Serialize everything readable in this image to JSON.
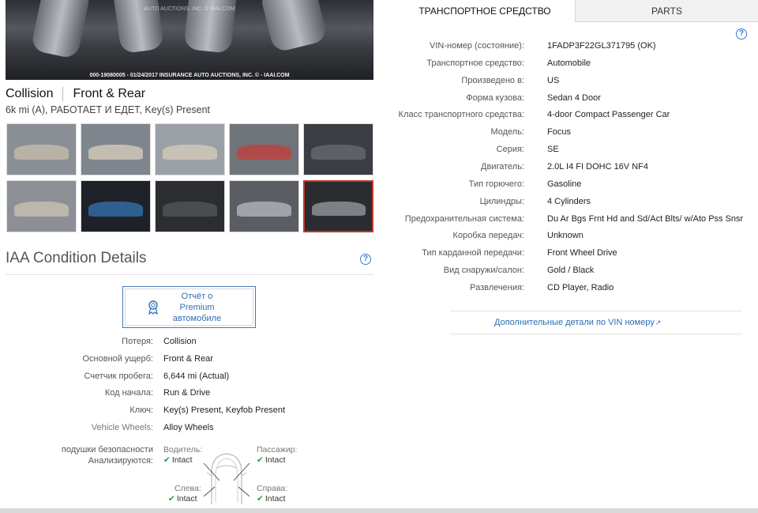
{
  "main_photo": {
    "watermark": "AUTO AUCTIONS, INC. © IAAI.COM",
    "caption": "000-19080005 - 01/24/2017 INSURANCE AUTO AUCTIONS, INC. © - IAAI.COM"
  },
  "vehicle": {
    "primary_damage_title": "Collision",
    "damage_location_title": "Front & Rear",
    "subtitle": "6k mi (A), РАБОТАЕТ И ЕДЕТ, Key(s) Present"
  },
  "thumbnails": [
    {
      "name": "thumb-1",
      "bg": "#8a8f96",
      "car": "#b9b2a6"
    },
    {
      "name": "thumb-2",
      "bg": "#7f858c",
      "car": "#c2bcb1"
    },
    {
      "name": "thumb-3",
      "bg": "#9aa0a6",
      "car": "#c8c1b5"
    },
    {
      "name": "thumb-4",
      "bg": "#6f747b",
      "car": "#b04a4a"
    },
    {
      "name": "thumb-5",
      "bg": "#3b3d42",
      "car": "#5e6066"
    },
    {
      "name": "thumb-6",
      "bg": "#8c9096",
      "car": "#bdb6aa"
    },
    {
      "name": "thumb-7",
      "bg": "#1e2228",
      "car": "#2f5f8f"
    },
    {
      "name": "thumb-8",
      "bg": "#2b2d31",
      "car": "#4a4c51"
    },
    {
      "name": "thumb-9",
      "bg": "#5a5d62",
      "car": "#9fa4aa"
    },
    {
      "name": "thumb-10",
      "bg": "#2a2c30",
      "car": "#7d8086"
    }
  ],
  "condition": {
    "title": "IAA Condition Details",
    "premium_button": "Отчёт о Premium автомобиле",
    "rows": [
      {
        "label": "Потеря:",
        "value": "Collision"
      },
      {
        "label": "Основной ущерб:",
        "value": "Front & Rear"
      },
      {
        "label": "Счетчик пробега:",
        "value": "6,644 mi (Actual)"
      },
      {
        "label": "Код начала:",
        "value": "Run & Drive"
      },
      {
        "label": "Ключ:",
        "value": "Key(s) Present, Keyfob Present"
      },
      {
        "label": "Vehicle Wheels:",
        "value": "Alloy Wheels"
      }
    ],
    "airbags_label_line1": "подушки безопасности",
    "airbags_label_line2": "Анализируются:",
    "airbags": {
      "driver": {
        "position": "Водитель:",
        "status": "Intact"
      },
      "passenger": {
        "position": "Пассажир:",
        "status": "Intact"
      },
      "left": {
        "position": "Слева:",
        "status": "Intact"
      },
      "right": {
        "position": "Справа:",
        "status": "Intact"
      }
    },
    "check_icon": "check-icon"
  },
  "tabs": {
    "vehicle": "ТРАНСПОРТНОЕ СРЕДСТВО",
    "parts": "PARTS"
  },
  "specs": [
    {
      "label": "VIN-номер (состояние):",
      "value": "1FADP3F22GL371795 (OK)"
    },
    {
      "label": "Транспортное средство:",
      "value": "Automobile"
    },
    {
      "label": "Произведено в:",
      "value": "US"
    },
    {
      "label": "Форма кузова:",
      "value": "Sedan 4 Door"
    },
    {
      "label": "Класс транспортного средства:",
      "value": "4-door Compact Passenger Car"
    },
    {
      "label": "Модель:",
      "value": "Focus"
    },
    {
      "label": "Серия:",
      "value": "SE"
    },
    {
      "label": "Двигатель:",
      "value": "2.0L I4 FI DOHC 16V NF4"
    },
    {
      "label": "Тип горючего:",
      "value": "Gasoline"
    },
    {
      "label": "Цилиндры:",
      "value": "4 Cylinders"
    },
    {
      "label": "Предохранительная система:",
      "value": "Du Ar Bgs Frnt Hd and Sd/Act Blts/ w/Ato Pss Snsr"
    },
    {
      "label": "Коробка передач:",
      "value": "Unknown"
    },
    {
      "label": "Тип карданной передачи:",
      "value": "Front Wheel Drive"
    },
    {
      "label": "Вид снаружи/салон:",
      "value": "Gold / Black"
    },
    {
      "label": "Развлечения:",
      "value": "CD Player, Radio"
    }
  ],
  "vin_link": "Дополнительные детали по VIN номеру",
  "colors": {
    "link": "#2e6db4",
    "check": "#2e9a3b",
    "selected_thumb_border": "#c0392b"
  }
}
